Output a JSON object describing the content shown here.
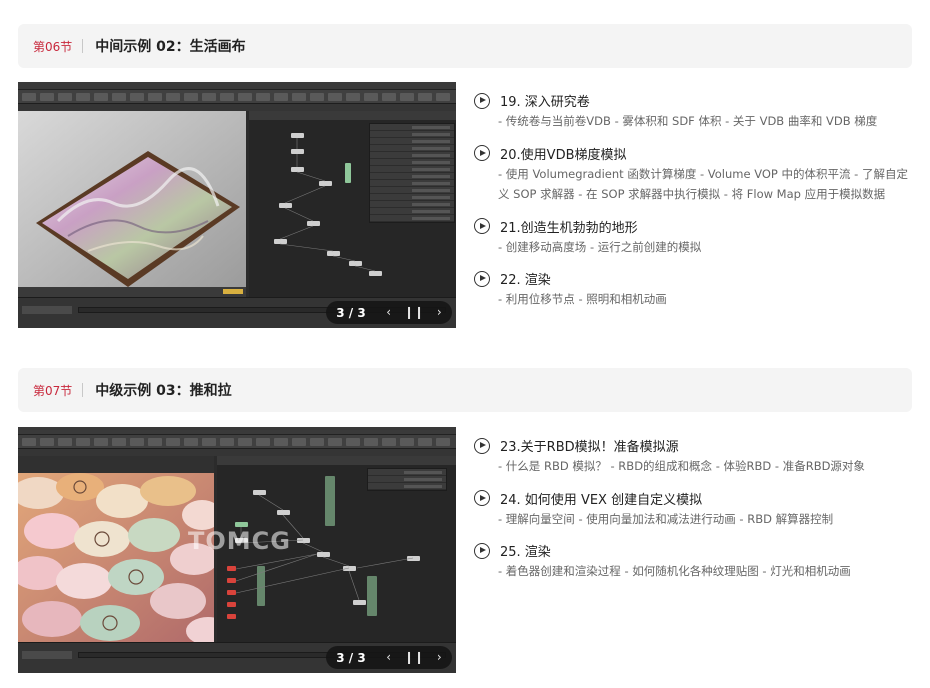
{
  "sections": [
    {
      "num": "第06节",
      "title": "中间示例 02：生活画布",
      "slider": {
        "counter": "3 / 3",
        "prev": "‹",
        "pause": "❙❙",
        "next": "›"
      },
      "items": [
        {
          "title": "19. 深入研究卷",
          "desc": "- 传统卷与当前卷VDB - 雾体积和 SDF 体积 - 关于 VDB 曲率和 VDB 梯度"
        },
        {
          "title": "20.使用VDB梯度模拟",
          "desc": "- 使用 Volumegradient 函数计算梯度 - Volume VOP 中的体积平流 - 了解自定义 SOP 求解器 - 在 SOP 求解器中执行模拟 - 将 Flow Map 应用于模拟数据"
        },
        {
          "title": "21.创造生机勃勃的地形",
          "desc": "- 创建移动高度场 - 运行之前创建的模拟"
        },
        {
          "title": "22. 渲染",
          "desc": "- 利用位移节点 - 照明和相机动画"
        }
      ]
    },
    {
      "num": "第07节",
      "title": "中级示例 03：推和拉",
      "slider": {
        "counter": "3 / 3",
        "prev": "‹",
        "pause": "❙❙",
        "next": "›"
      },
      "watermark": "TOMCG",
      "items": [
        {
          "title": "23.关于RBD模拟！准备模拟源",
          "desc": "- 什么是 RBD 模拟？ - RBD的组成和概念 - 体验RBD - 准备RBD源对象"
        },
        {
          "title": "24. 如何使用 VEX 创建自定义模拟",
          "desc": "- 理解向量空间 - 使用向量加法和减法进行动画 - RBD 解算器控制"
        },
        {
          "title": "25. 渲染",
          "desc": "- 着色器创建和渲染过程 - 如何随机化各种纹理贴图 - 灯光和相机动画"
        }
      ]
    }
  ]
}
